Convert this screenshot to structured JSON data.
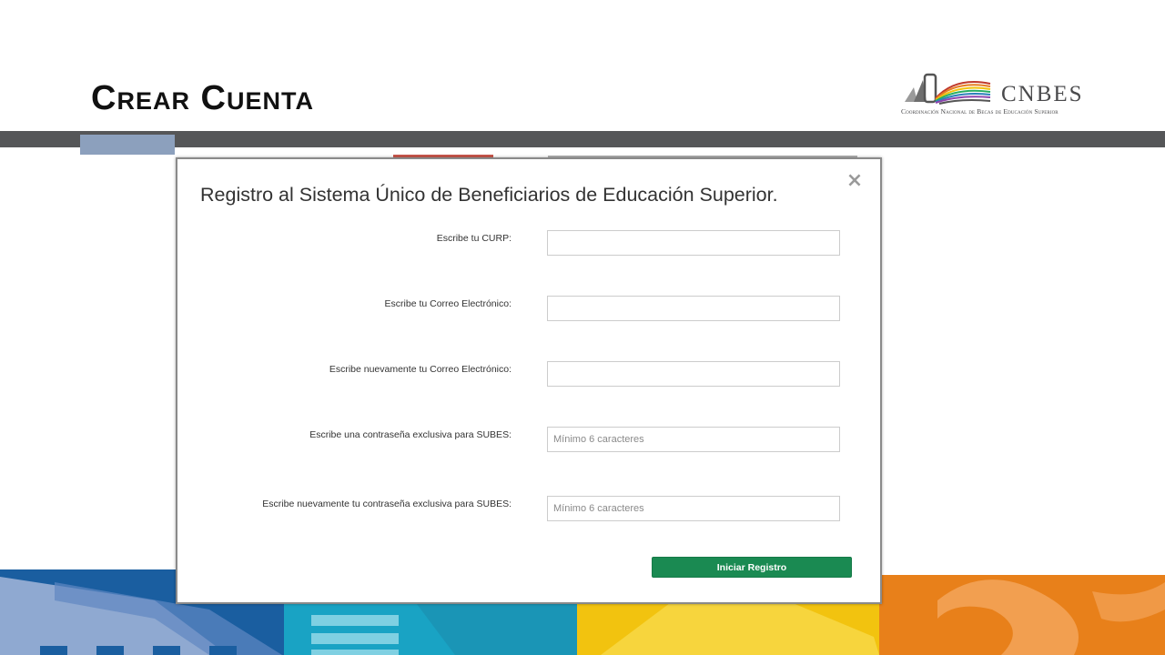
{
  "slide": {
    "title": "Crear Cuenta"
  },
  "logo": {
    "name": "CNBES",
    "subtitle": "Coordinación Nacional de Becas de Educación Superior"
  },
  "modal": {
    "title": "Registro al Sistema Único de Beneficiarios de Educación Superior.",
    "close_label": "×",
    "fields": [
      {
        "label": "Escribe tu CURP:",
        "value": "",
        "placeholder": ""
      },
      {
        "label": "Escribe tu Correo Electrónico:",
        "value": "",
        "placeholder": ""
      },
      {
        "label": "Escribe nuevamente tu Correo Electrónico:",
        "value": "",
        "placeholder": ""
      },
      {
        "label": "Escribe una contraseña exclusiva para SUBES:",
        "value": "",
        "placeholder": "Mínimo 6 caracteres"
      },
      {
        "label": "Escribe nuevamente tu contraseña exclusiva para SUBES:",
        "value": "",
        "placeholder": "Mínimo 6 caracteres"
      }
    ],
    "submit_label": "Iniciar Registro"
  },
  "colors": {
    "header_bar": "#555658",
    "header_accent": "#8ca0bd",
    "submit_button": "#1a8a52"
  },
  "icons": {
    "close": "close-icon",
    "logo": "book-rainbow-logo-icon"
  }
}
